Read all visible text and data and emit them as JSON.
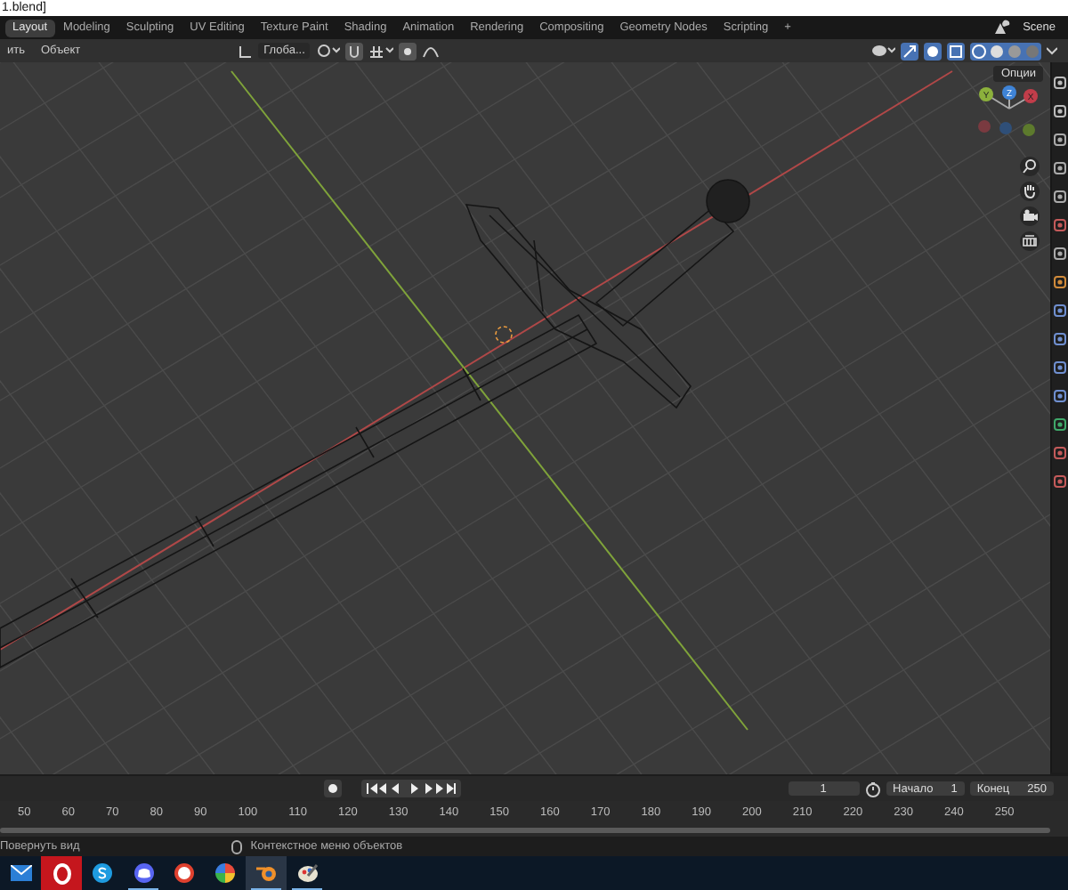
{
  "window": {
    "title": "1.blend]"
  },
  "workspaces": [
    {
      "label": "Layout",
      "selected": true
    },
    {
      "label": "Modeling",
      "selected": false
    },
    {
      "label": "Sculpting",
      "selected": false
    },
    {
      "label": "UV Editing",
      "selected": false
    },
    {
      "label": "Texture Paint",
      "selected": false
    },
    {
      "label": "Shading",
      "selected": false
    },
    {
      "label": "Animation",
      "selected": false
    },
    {
      "label": "Rendering",
      "selected": false
    },
    {
      "label": "Compositing",
      "selected": false
    },
    {
      "label": "Geometry Nodes",
      "selected": false
    },
    {
      "label": "Scripting",
      "selected": false
    }
  ],
  "add_workspace": "+",
  "scene": "Scene",
  "header": {
    "menus": [
      "ить",
      "Объект"
    ],
    "orientation": "Глоба...",
    "options": "Опции"
  },
  "gizmo": {
    "y": "Y",
    "z": "Z",
    "x": "X"
  },
  "timeline": {
    "current_frame": "1",
    "start_label": "Начало",
    "start": "1",
    "end_label": "Конец",
    "end": "250",
    "ruler": [
      "50",
      "60",
      "70",
      "80",
      "90",
      "100",
      "110",
      "120",
      "130",
      "140",
      "150",
      "160",
      "170",
      "180",
      "190",
      "200",
      "210",
      "220",
      "230",
      "240",
      "250"
    ]
  },
  "status_bar": [
    "Повернуть вид",
    "Контекстное меню объектов"
  ],
  "taskbar": [
    {
      "kind": "mail",
      "running": false,
      "selected": false
    },
    {
      "kind": "opera",
      "running": false,
      "selected": false
    },
    {
      "kind": "skype",
      "running": false,
      "selected": false
    },
    {
      "kind": "discord",
      "running": true,
      "selected": false
    },
    {
      "kind": "ring",
      "running": false,
      "selected": false
    },
    {
      "kind": "wheel",
      "running": false,
      "selected": false
    },
    {
      "kind": "blender",
      "running": true,
      "selected": true
    },
    {
      "kind": "paint",
      "running": true,
      "selected": false
    }
  ]
}
